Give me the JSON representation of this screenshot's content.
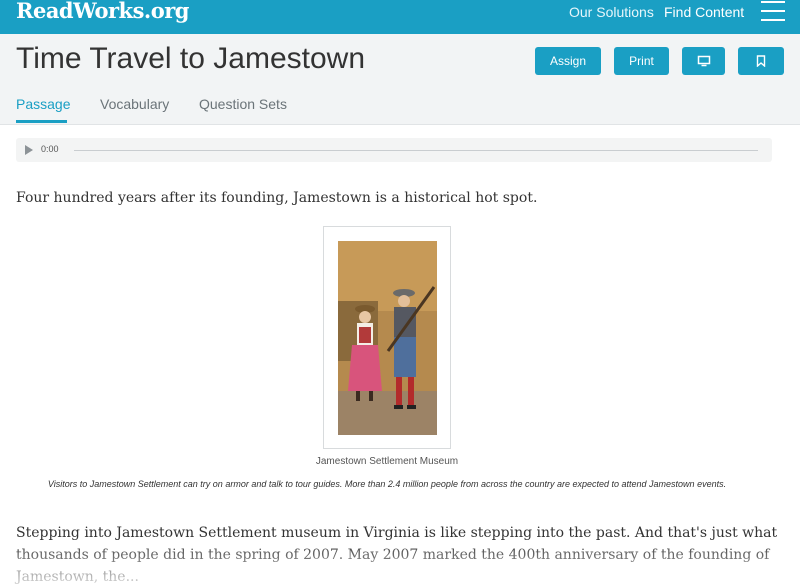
{
  "header": {
    "logo": "ReadWorks.org",
    "nav": [
      "Our Solutions",
      "Find Content"
    ]
  },
  "page": {
    "title": "Time Travel to Jamestown",
    "buttons": {
      "assign": "Assign",
      "print": "Print"
    },
    "tabs": [
      "Passage",
      "Vocabulary",
      "Question Sets"
    ],
    "active_tab": "Passage"
  },
  "audio": {
    "time": "0:00"
  },
  "passage": {
    "intro": "Four hundred years after its founding, Jamestown is a historical hot spot.",
    "photo_credit": "Jamestown Settlement Museum",
    "caption": "Visitors to Jamestown Settlement can try on armor and talk to tour guides. More than 2.4 million people from across the country are expected to attend Jamestown events.",
    "body": "Stepping into Jamestown Settlement museum in Virginia is like stepping into the past. And that's just what thousands of people did in the spring of 2007. May 2007 marked the 400th anniversary of the founding of Jamestown, the..."
  },
  "colors": {
    "brand": "#1a9fc4",
    "title_bar": "#f2f4f5"
  },
  "icons": [
    "play-icon",
    "menu-icon",
    "present-icon",
    "bookmark-icon"
  ]
}
